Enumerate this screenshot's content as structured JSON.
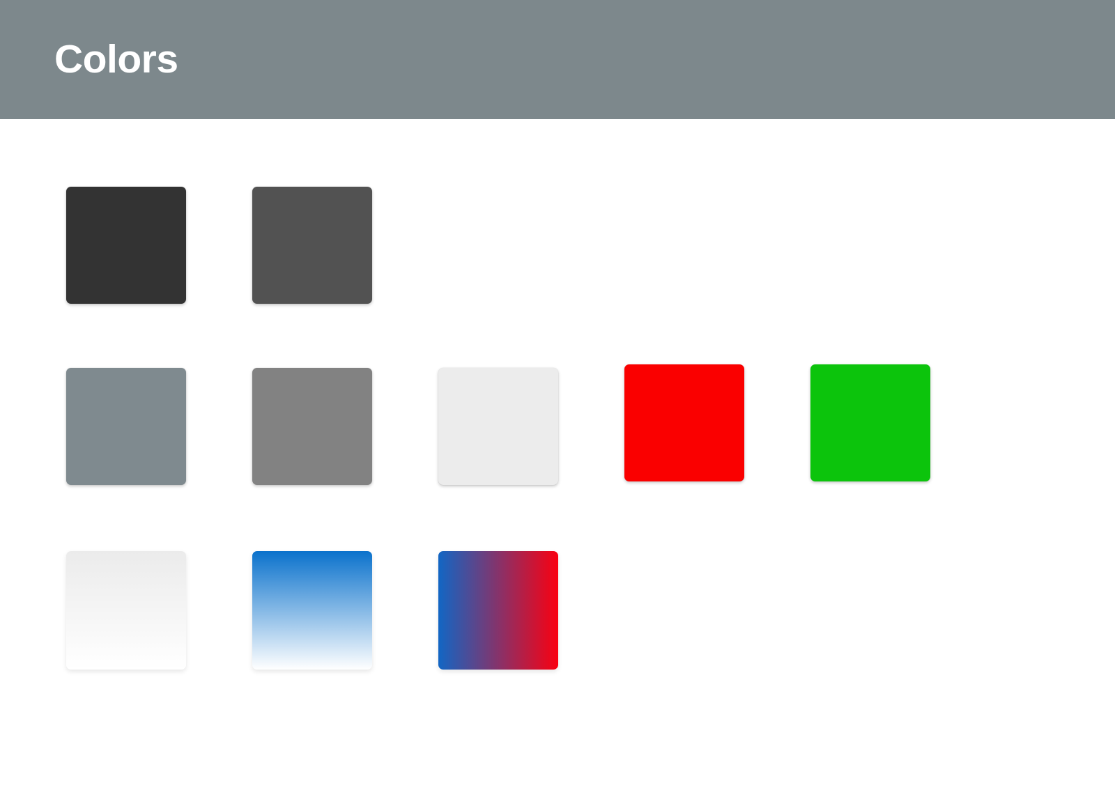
{
  "header": {
    "title": "Colors",
    "background_color": "#7d888c",
    "title_color": "#ffffff"
  },
  "page": {
    "background_color": "#ffffff"
  },
  "swatches": {
    "rows": [
      {
        "row_name": "dark-neutrals",
        "items": [
          {
            "name": "dark-charcoal",
            "style": "solid",
            "color": "#333333",
            "shadow": "shadowed"
          },
          {
            "name": "dark-gray",
            "style": "solid",
            "color": "#525252",
            "shadow": "shadowed"
          },
          {
            "name": "empty-slot-1",
            "style": "empty",
            "color": "",
            "shadow": "none"
          },
          {
            "name": "empty-slot-2",
            "style": "empty",
            "color": "",
            "shadow": "none"
          },
          {
            "name": "empty-slot-3",
            "style": "empty",
            "color": "",
            "shadow": "none"
          }
        ]
      },
      {
        "row_name": "mid-neutrals-and-accents",
        "items": [
          {
            "name": "blue-gray",
            "style": "solid",
            "color": "#7f8a8f",
            "shadow": "shadowed"
          },
          {
            "name": "neutral-gray",
            "style": "solid",
            "color": "#828282",
            "shadow": "shadowed"
          },
          {
            "name": "light-gray",
            "style": "solid",
            "color": "#ececec",
            "shadow": "shadowed"
          },
          {
            "name": "accent-red",
            "style": "solid",
            "color": "#fa0000",
            "shadow": "shadowed"
          },
          {
            "name": "accent-green",
            "style": "solid",
            "color": "#0cc40c",
            "shadow": "shadowed"
          }
        ]
      },
      {
        "row_name": "gradients",
        "items": [
          {
            "name": "gray-to-white-gradient",
            "style": "linear-gradient",
            "direction": "to bottom",
            "from": "#ebebeb",
            "to": "#ffffff",
            "shadow": "soft"
          },
          {
            "name": "blue-to-white-gradient",
            "style": "linear-gradient",
            "direction": "to bottom",
            "from": "#0b72cc",
            "to": "#ffffff",
            "shadow": "soft"
          },
          {
            "name": "blue-to-red-gradient",
            "style": "linear-gradient",
            "direction": "to right",
            "from": "#1266c4",
            "to": "#fa0011",
            "shadow": "soft"
          },
          {
            "name": "empty-slot-4",
            "style": "empty",
            "color": "",
            "shadow": "none"
          },
          {
            "name": "empty-slot-5",
            "style": "empty",
            "color": "",
            "shadow": "none"
          }
        ]
      }
    ]
  }
}
